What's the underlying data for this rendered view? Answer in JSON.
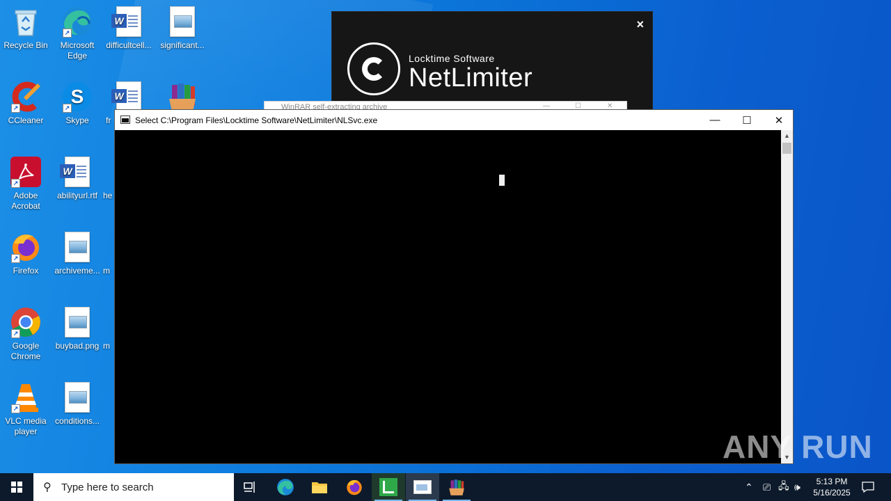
{
  "desktop": {
    "icons": [
      {
        "label": "Recycle Bin"
      },
      {
        "label": "Microsoft Edge"
      },
      {
        "label": "difficultcell..."
      },
      {
        "label": "significant..."
      },
      {
        "label": "CCleaner"
      },
      {
        "label": "Skype"
      },
      {
        "label": "fr"
      },
      {
        "label": ""
      },
      {
        "label": "Adobe Acrobat"
      },
      {
        "label": "abilityurl.rtf"
      },
      {
        "label": "he"
      },
      {
        "label": "Firefox"
      },
      {
        "label": "archiveme..."
      },
      {
        "label": "m"
      },
      {
        "label": "Google Chrome"
      },
      {
        "label": "buybad.png"
      },
      {
        "label": "m"
      },
      {
        "label": "VLC media player"
      },
      {
        "label": "conditions..."
      }
    ]
  },
  "splash": {
    "brand_small": "Locktime Software",
    "brand_big": "NetLimiter",
    "close": "×"
  },
  "winrar": {
    "title": "WinRAR self-extracting archive"
  },
  "console": {
    "title": "Select C:\\Program Files\\Locktime Software\\NetLimiter\\NLSvc.exe",
    "minimize": "—",
    "maximize": "☐",
    "close": "✕"
  },
  "watermark": "ANY RUN",
  "taskbar": {
    "search_placeholder": "Type here to search",
    "time": "5:13 PM",
    "date": "5/16/2025"
  }
}
